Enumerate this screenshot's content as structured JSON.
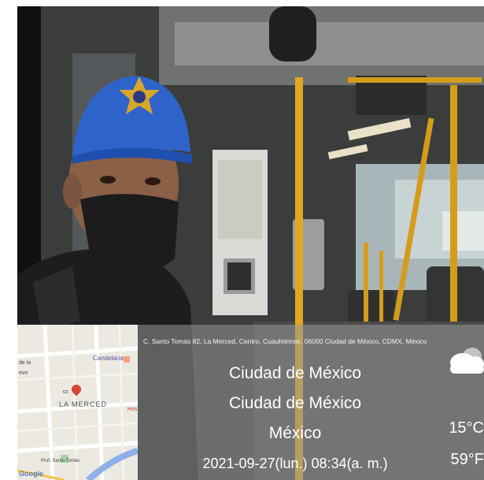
{
  "overlay": {
    "address": "C. Santo Tomás 82, La Merced, Centro, Cuauhtémoc, 06000 Ciudad de México, CDMX, México",
    "city": "Ciudad de México",
    "state": "Ciudad de México",
    "country": "México",
    "datetime": "2021-09-27(lun.)  08:34(a. m.)",
    "temp_c": "15°C",
    "temp_f": "59°F",
    "weather_icon": "cloud-icon"
  },
  "map": {
    "place_label": "LA MERCED",
    "street_labels": [
      "Candelaria",
      "de la",
      "evo",
      "cc",
      "Hos",
      "Prof. Santo Tomás"
    ],
    "provider": "Google"
  },
  "colors": {
    "cap": "#2e63c9",
    "badge": "#d8a62a",
    "pole": "#e0a820",
    "mask": "#1c1c1c"
  }
}
